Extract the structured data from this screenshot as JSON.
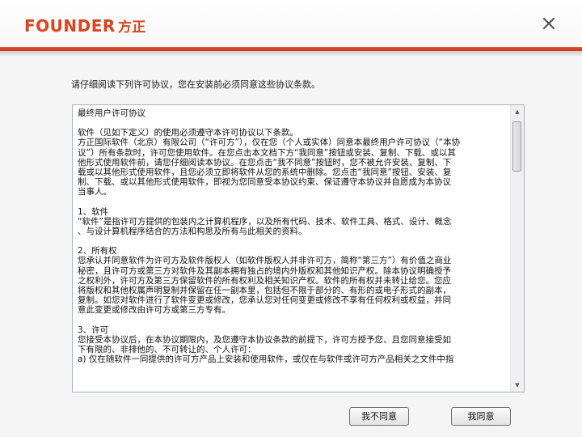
{
  "header": {
    "logo_main": "FOUNDER",
    "logo_sub": "方正",
    "close_icon": "close-icon"
  },
  "intro": "请仔细阅读下列许可协议，您在安装前必须同意这些协议条款。",
  "license": {
    "lines": [
      "最终用户许可协议",
      "",
      "软件（见如下定义）的使用必须遵守本许可协议以下条款。",
      "方正国际软件（北京）有限公司（“许可方”），仅在您（个人或实体）同意本最终用户许可协议（“本协",
      "议”）所有条款时，许可您使用软件。在您点击本文档下方“我同意”按钮或安装、复制、下载、或以其",
      "他形式使用软件前，请您仔细阅读本协议。在您点击“我不同意”按钮时，您不被允许安装、复制、下",
      "载或以其他形式使用软件，且您必须立即将软件从您的系统中删除。您点击“我同意”按钮、安装、复",
      "制、下载、或以其他形式使用软件，即视为您同意受本协议约束、保证遵守本协议并自愿成为本协议",
      "当事人。",
      "",
      "1、软件",
      "“软件”是指许可方提供的包装内之计算机程序，以及所有代码、技术、软件工具、格式、设计、概念",
      "、与设计算机程序结合的方法和构思及所有与此相关的资料。",
      "",
      "2、所有权",
      "您承认并同意软件为许可方及软件版权人（如软件版权人并非许可方，简称“第三方”）有价值之商业",
      "秘密，且许可方或第三方对软件及其副本拥有独占的境内外版权和其他知识产权。除本协议明确授予",
      "之权利外，许可方及第三方保留软件的所有权利及相关知识产权。软件的所有权并未转让给您。您应",
      "将版权和其他权属声明复制并保留在任一副本里，包括但不限于部分的、有形的或电子形式的副本，",
      "复制。如您对软件进行了软件变更或修改，您承认您对任何变更或修改不享有任何权利或权益，并同",
      "意此变更或修改由许可方或第三方专有。",
      "",
      "3、许可",
      "您接受本协议后，在本协议期限内，及您遵守本协议条款的前提下，许可方授予您、且您同意接受如",
      "下有限的、非排他的、不可转让的、个人许可：",
      "a) 仅在随软件一同提供的许可方产品上安装和使用软件，或仅在与软件或许可方产品相关之文件中指"
    ]
  },
  "buttons": {
    "disagree": "我不同意",
    "agree": "我同意"
  },
  "colors": {
    "brand": "#d8461f",
    "accent_stripe": "#d23a22"
  }
}
